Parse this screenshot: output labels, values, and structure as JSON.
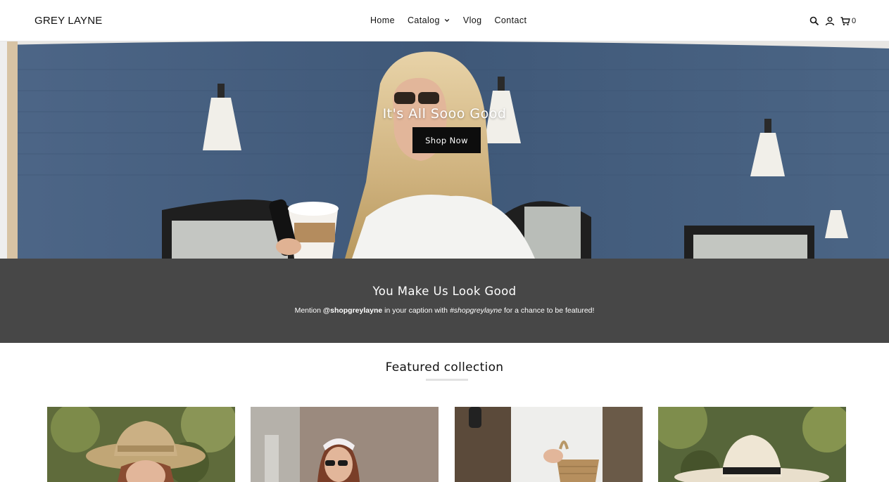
{
  "header": {
    "logo": "GREY LAYNE",
    "nav": {
      "home": "Home",
      "catalog": "Catalog",
      "vlog": "Vlog",
      "contact": "Contact"
    },
    "cart_count": "0",
    "icons": [
      "search-icon",
      "account-icon",
      "cart-icon"
    ]
  },
  "hero": {
    "title": "It's All Sooo Good",
    "button": "Shop Now"
  },
  "banner": {
    "title": "You Make Us Look Good",
    "text_prefix": "Mention ",
    "handle": "@shopgreylayne",
    "text_middle": " in your caption with ",
    "hashtag": "#shopgreylayne",
    "text_suffix": " for a chance to be featured!"
  },
  "featured": {
    "title": "Featured collection",
    "products": [
      {
        "image": "woman-straw-hat"
      },
      {
        "image": "woman-headband"
      },
      {
        "image": "straw-bag"
      },
      {
        "image": "panama-hat"
      }
    ]
  },
  "colors": {
    "banner_bg": "#474747",
    "button_bg": "#0d0d0d",
    "hero_wall": "#4a6486"
  }
}
